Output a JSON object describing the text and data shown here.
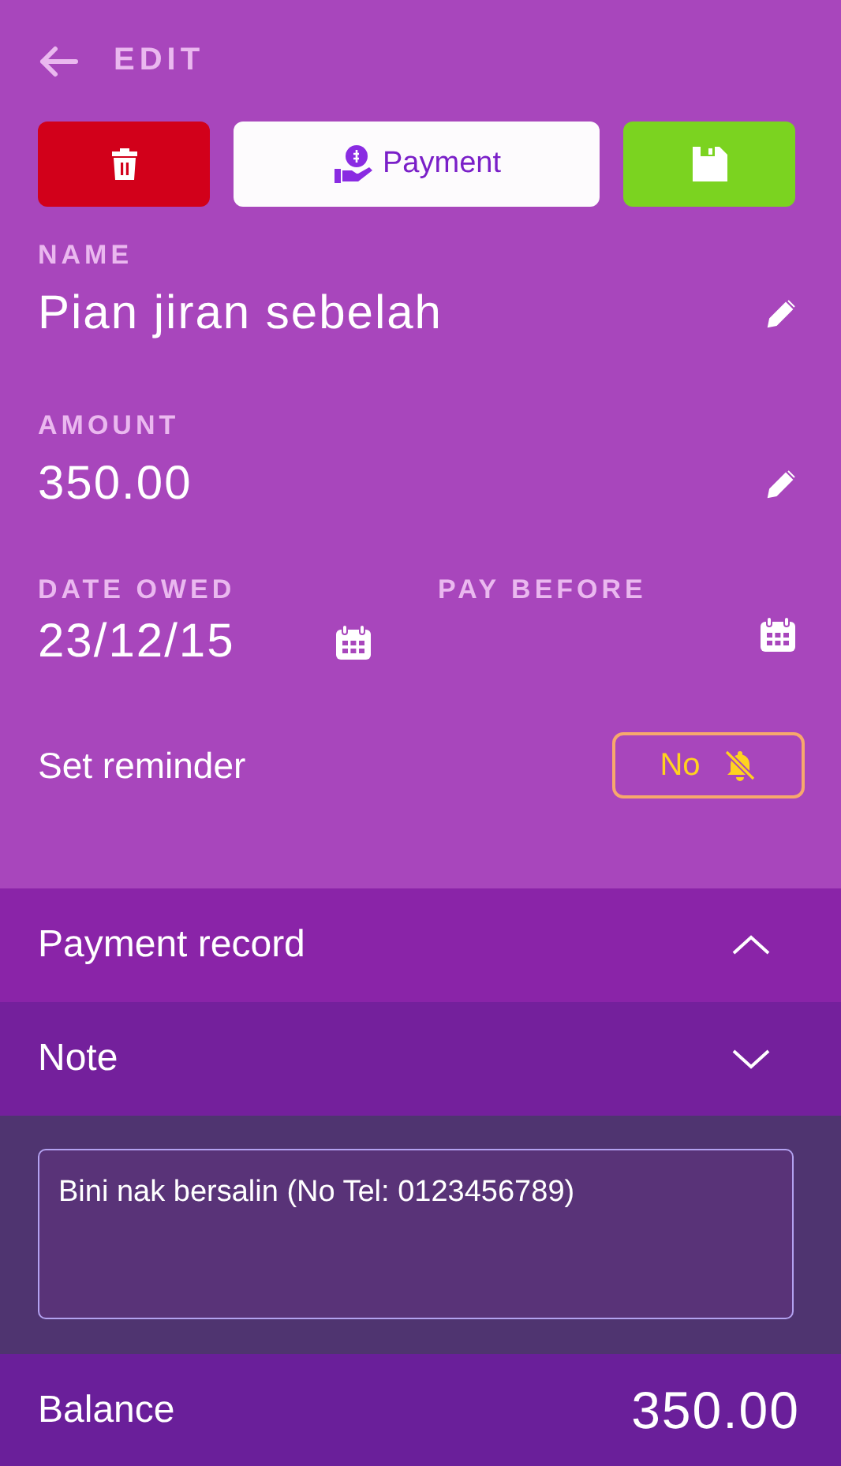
{
  "header": {
    "title": "EDIT"
  },
  "actions": {
    "payment_label": "Payment"
  },
  "fields": [
    {
      "kind": "editable",
      "label": "NAME",
      "value": "Pian jiran sebelah"
    },
    {
      "kind": "editable",
      "label": "AMOUNT",
      "value": "350.00"
    }
  ],
  "dates": [
    {
      "label": "DATE OWED",
      "value": "23/12/15"
    },
    {
      "label": "PAY BEFORE"
    }
  ],
  "reminder": {
    "label": "Set reminder",
    "value": "No",
    "on": false
  },
  "sections": [
    {
      "title": "Payment record",
      "expanded": false
    },
    {
      "title": "Note",
      "expanded": true
    }
  ],
  "note": {
    "value": "Bini nak bersalin (No Tel: 0123456789)"
  },
  "balance": {
    "label": "Balance",
    "value": "350.00"
  }
}
